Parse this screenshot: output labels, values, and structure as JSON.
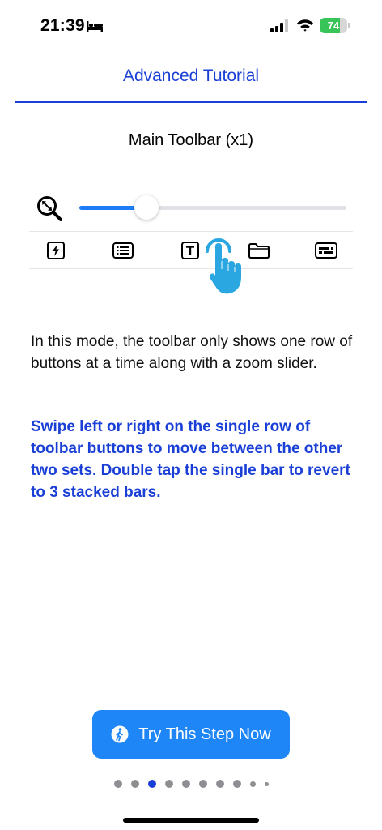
{
  "status_bar": {
    "time": "21:39",
    "battery_percent": 74,
    "battery_label": "74"
  },
  "header": {
    "title": "Advanced Tutorial"
  },
  "section": {
    "title": "Main Toolbar (x1)"
  },
  "zoom_slider": {
    "value_fraction": 0.25
  },
  "toolbar": {
    "tools": [
      {
        "icon": "lightning-icon"
      },
      {
        "icon": "list-icon"
      },
      {
        "icon": "text-box-icon"
      },
      {
        "icon": "folder-icon"
      },
      {
        "icon": "keyboard-icon"
      }
    ]
  },
  "content": {
    "description": "In this mode, the toolbar only shows one row of buttons at a time along with a zoom slider.",
    "instruction": "Swipe left or right on the single row of toolbar buttons to move between the other two sets. Double tap the single bar to revert to 3 stacked bars."
  },
  "cta": {
    "label": "Try This Step Now"
  },
  "pagination": {
    "current_index": 2
  },
  "colors": {
    "accent_blue": "#1a3fd6",
    "button_blue": "#1f86f7",
    "slider_blue": "#1f7cf7",
    "hand_blue": "#2aa6e0",
    "battery_green": "#39c45a"
  }
}
